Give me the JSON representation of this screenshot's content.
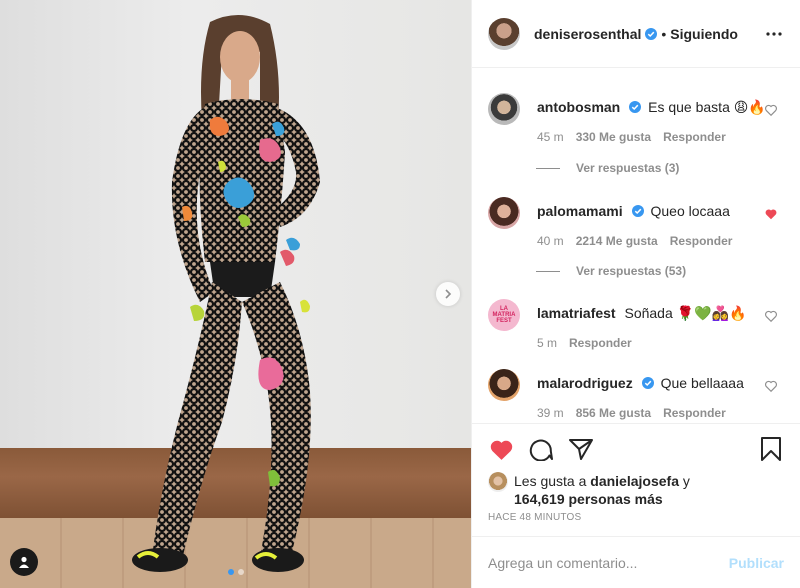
{
  "header": {
    "username": "deniserosenthal",
    "separator": "•",
    "follow_status": "Siguiendo"
  },
  "comments": [
    {
      "username": "antobosman",
      "verified": true,
      "text": "Es que basta 😩🔥",
      "time": "45 m",
      "likes": "330 Me gusta",
      "reply_label": "Responder",
      "liked": false,
      "view_replies": "Ver respuestas (3)"
    },
    {
      "username": "palomamami",
      "verified": true,
      "text": "Queo locaaa",
      "time": "40 m",
      "likes": "2214 Me gusta",
      "reply_label": "Responder",
      "liked": true,
      "view_replies": "Ver respuestas (53)"
    },
    {
      "username": "lamatriafest",
      "verified": false,
      "text": "Soñada 🌹💚👩‍❤️‍👩🔥",
      "time": "5 m",
      "reply_label": "Responder",
      "liked": false,
      "avatar_text": "LA MATRIA FEST"
    },
    {
      "username": "malarodriguez",
      "verified": true,
      "text": "Que bellaaaa",
      "time": "39 m",
      "likes": "856 Me gusta",
      "reply_label": "Responder",
      "liked": false
    }
  ],
  "likes": {
    "prefix": "Les gusta a",
    "user": "danielajosefa",
    "conjunction": "y",
    "count_text": "164,619 personas más"
  },
  "time_ago": "HACE 48 MINUTOS",
  "add_comment": {
    "placeholder": "Agrega un comentario...",
    "publish_label": "Publicar"
  },
  "carousel": {
    "total": 2,
    "active": 1
  },
  "colors": {
    "text": "#262626",
    "secondary": "#8e8e8e",
    "verified": "#3897f0",
    "heart_red": "#ed4956",
    "publish_disabled": "#b2dffc",
    "border": "#efefef"
  },
  "icons": {
    "more": "more-horizontal-icon",
    "like": "heart-filled-icon",
    "comment": "comment-bubble-icon",
    "share": "paper-plane-icon",
    "save": "bookmark-icon",
    "next": "chevron-right-icon",
    "tag": "user-tag-icon"
  }
}
